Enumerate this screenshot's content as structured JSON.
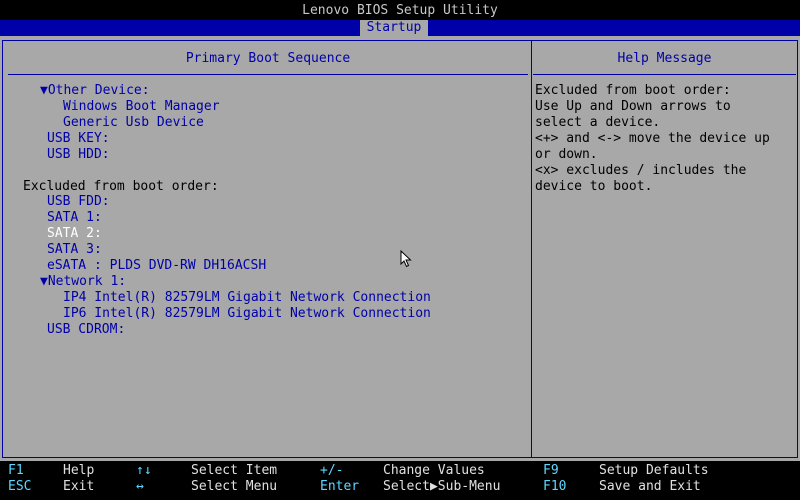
{
  "app": {
    "title": "Lenovo BIOS Setup Utility"
  },
  "tabs": [
    {
      "label": "Startup",
      "active": true
    }
  ],
  "left_panel": {
    "title": "Primary Boot Sequence",
    "rows": [
      {
        "text": "▼Other Device:"
      },
      {
        "text": "Windows Boot Manager"
      },
      {
        "text": "Generic Usb Device"
      },
      {
        "text": "USB KEY:"
      },
      {
        "text": "USB HDD:"
      },
      {
        "text": "Excluded from boot order:"
      },
      {
        "text": "USB FDD:"
      },
      {
        "text": "SATA 1:"
      },
      {
        "text": "SATA 2:",
        "selected": true
      },
      {
        "text": "SATA 3:"
      },
      {
        "text": "eSATA : PLDS DVD-RW DH16ACSH"
      },
      {
        "text": "▼Network 1:"
      },
      {
        "text": "IP4 Intel(R) 82579LM Gigabit Network Connection"
      },
      {
        "text": "IP6 Intel(R) 82579LM Gigabit Network Connection"
      },
      {
        "text": "USB CDROM:"
      }
    ]
  },
  "help_panel": {
    "title": "Help Message",
    "lines": [
      "Excluded from boot order:",
      "Use Up and Down arrows to",
      "select a device.",
      "<+> and <-> move the device up",
      "or down.",
      "<x> excludes / includes the",
      "device to boot."
    ]
  },
  "footer": {
    "items": [
      {
        "key": "F1",
        "label": "Help"
      },
      {
        "key": "ESC",
        "label": "Exit"
      },
      {
        "key": "↑↓",
        "label": "Select Item"
      },
      {
        "key": "↔",
        "label": "Select Menu"
      },
      {
        "key": "+/-",
        "label": "Change Values"
      },
      {
        "key": "Enter",
        "label": "Select▶Sub-Menu"
      },
      {
        "key": "F9",
        "label": "Setup Defaults"
      },
      {
        "key": "F10",
        "label": "Save and Exit"
      }
    ]
  },
  "colors": {
    "panel_bg": "#a8a8a8",
    "accent_blue": "#0000a8",
    "selected_text": "#ffffff",
    "footer_bg": "#000000",
    "footer_key": "#5fd7ff"
  },
  "icons": {
    "cursor": "mouse-pointer-icon"
  }
}
